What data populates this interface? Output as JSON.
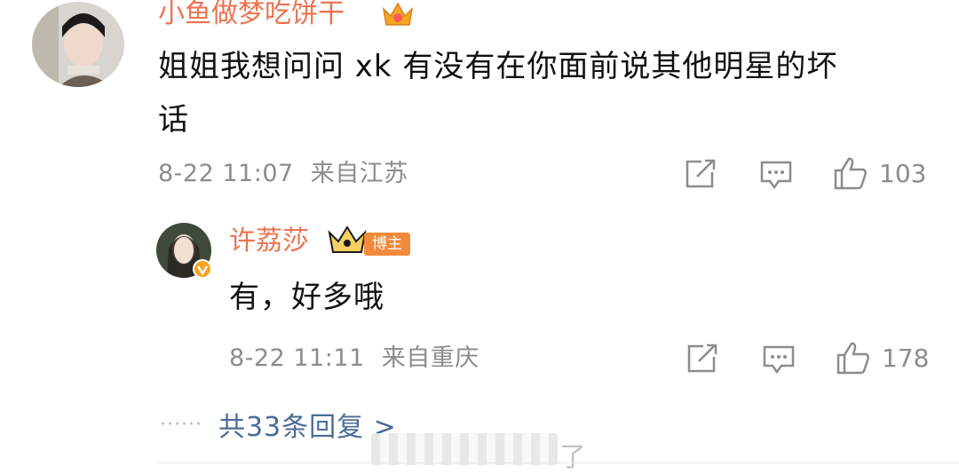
{
  "comment": {
    "username": "小鱼做梦吃饼干",
    "username_color": "#eb7350",
    "text_line1": "姐姐我想问问 xk 有没有在你面前说其他明星的坏",
    "text_line2": "话",
    "timestamp": "8-22 11:07",
    "location": "来自江苏",
    "like_count": "103",
    "icons": [
      "share-icon",
      "comment-icon",
      "like-icon"
    ]
  },
  "reply": {
    "username": "许荔莎",
    "username_color": "#eb7350",
    "badge_label": "博主",
    "badge_color": "#f28a3b",
    "text": "有，好多哦",
    "timestamp": "8-22 11:11",
    "location": "来自重庆",
    "like_count": "178",
    "icons": [
      "share-icon",
      "comment-icon",
      "like-icon"
    ]
  },
  "more_replies": {
    "label": "共33条回复 >",
    "link_color": "#4a6c97"
  },
  "watermark": {
    "tail": "了"
  }
}
